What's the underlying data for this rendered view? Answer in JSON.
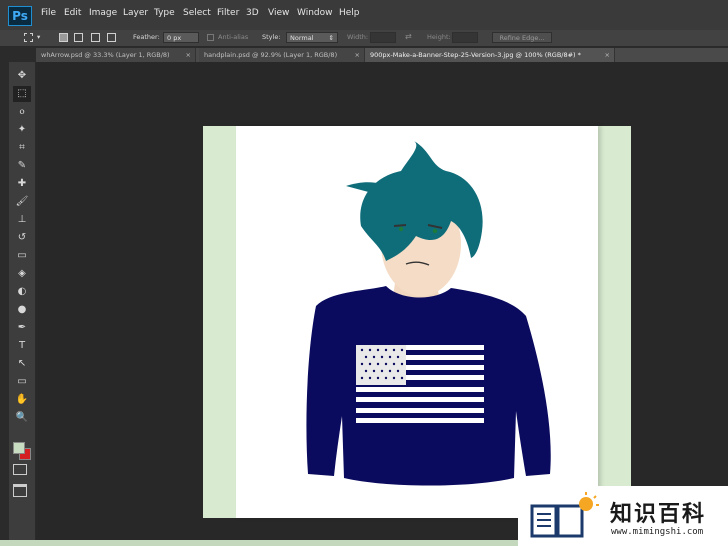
{
  "app": {
    "logo_text": "Ps"
  },
  "menu": [
    "File",
    "Edit",
    "Image",
    "Layer",
    "Type",
    "Select",
    "Filter",
    "3D",
    "View",
    "Window",
    "Help"
  ],
  "options_bar": {
    "feather_label": "Feather:",
    "feather_value": "0 px",
    "anti_alias_label": "Anti-alias",
    "style_label": "Style:",
    "style_value": "Normal",
    "width_label": "Width:",
    "height_label": "Height:",
    "refine_edge_label": "Refine Edge..."
  },
  "tabs": [
    {
      "label": "whArrow.psd @ 33.3% (Layer 1, RGB/8)",
      "close": "×"
    },
    {
      "label": "handplain.psd @ 92.9% (Layer 1, RGB/8)",
      "close": "×"
    },
    {
      "label": "900px-Make-a-Banner-Step-25-Version-3.jpg @ 100% (RGB/8#) *",
      "close": "×"
    }
  ],
  "tools": [
    "move-tool",
    "marquee-tool",
    "lasso-tool",
    "magic-wand-tool",
    "crop-tool",
    "eyedropper-tool",
    "healing-brush-tool",
    "brush-tool",
    "clone-stamp-tool",
    "history-brush-tool",
    "eraser-tool",
    "paint-bucket-tool",
    "blur-tool",
    "dodge-tool",
    "pen-tool",
    "type-tool",
    "path-selection-tool",
    "shape-tool",
    "hand-tool",
    "zoom-tool"
  ],
  "tool_glyphs": [
    "✥",
    "⬚",
    "ⲟ",
    "✦",
    "⌗",
    "✎",
    "✚",
    "🖌",
    "⊥",
    "↺",
    "▭",
    "◈",
    "◐",
    "●",
    "✒",
    "T",
    "↖",
    "▭",
    "✋",
    "🔍"
  ],
  "colors": {
    "foreground": "#c7dcc0",
    "background": "#d42020",
    "canvas_green": "#d8ead0",
    "shirt": "#0a0a5e",
    "hair": "#0f6d7a"
  },
  "watermark": {
    "title": "知识百科",
    "url": "www.mimingshi.com"
  }
}
